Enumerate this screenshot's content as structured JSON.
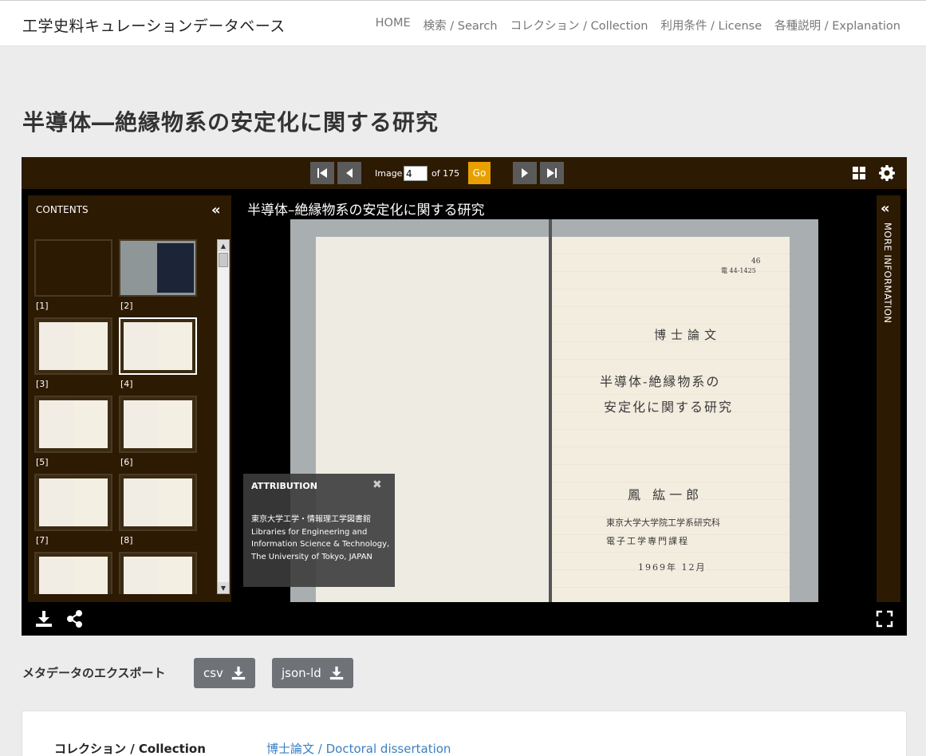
{
  "nav": {
    "brand": "工学史料キュレーションデータベース",
    "links": [
      "HOME",
      "検索 / Search",
      "コレクション / Collection",
      "利用条件 / License",
      "各種説明 / Explanation"
    ]
  },
  "page_title": "半導体―絶縁物系の安定化に関する研究",
  "viewer": {
    "image_label": "Image",
    "current_page": "4",
    "of_label": "of 175",
    "go_label": "Go",
    "contents_title": "CONTENTS",
    "doc_title": "半導体–絶縁物系の安定化に関する研究",
    "thumb_labels": [
      "[1]",
      "[2]",
      "[3]",
      "[4]",
      "[5]",
      "[6]",
      "[7]",
      "[8]"
    ],
    "attribution": {
      "title": "ATTRIBUTION",
      "text": "東京大学工学・情報理工学図書館 Libraries for Engineering and Information Science & Technology, The University of Tokyo, JAPAN"
    },
    "more_info_label": "MORE INFORMATION",
    "handwriting": {
      "stamp": "46",
      "stamp2": "電 44-1425",
      "heading": "博士論文",
      "title_line1": "半導体-絶縁物系の",
      "title_line2": "安定化に関する研究",
      "author": "鳳 紘一郎",
      "affiliation1": "東京大学大学院工学系研究科",
      "affiliation2": "電子工学専門課程",
      "date": "1969年 12月"
    }
  },
  "export": {
    "label": "メタデータのエクスポート",
    "csv": "csv",
    "jsonld": "json-ld"
  },
  "metadata": {
    "collection_label": "コレクション / Collection",
    "collection_value": "博士論文 / Doctoral dissertation"
  }
}
